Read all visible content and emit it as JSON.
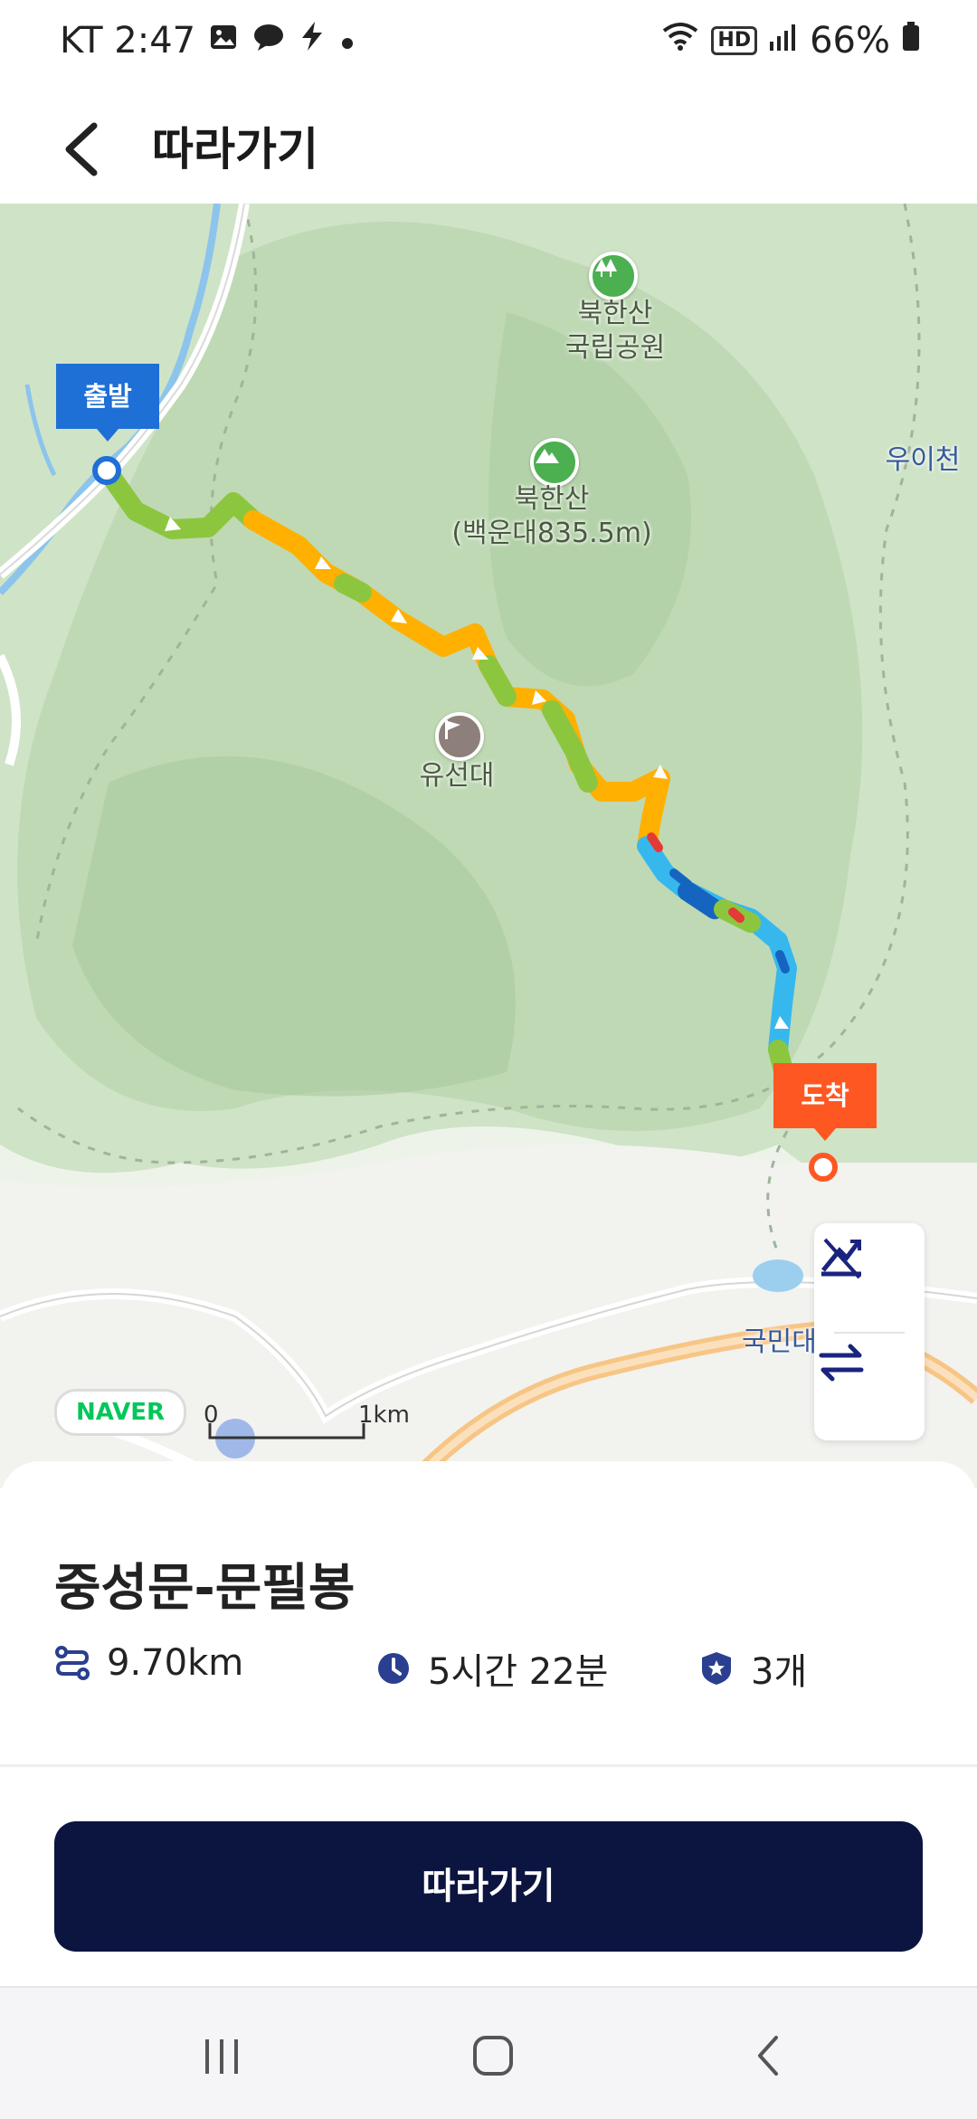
{
  "status_bar": {
    "time": "KT 2:47",
    "battery": "66%",
    "network_badge": "HD",
    "icons": [
      "image-icon",
      "chat-icon",
      "bolt-icon",
      "dot-icon",
      "wifi-icon",
      "signal-icon",
      "battery-icon"
    ]
  },
  "header": {
    "title": "따라가기",
    "back_icon": "chevron-left-icon"
  },
  "map": {
    "provider_logo": "NAVER",
    "scale_start": "0",
    "scale_end": "1km",
    "start_marker": "출발",
    "end_marker": "도착",
    "pois": [
      {
        "name": "북한산\n국립공원",
        "icon": "tree-icon"
      },
      {
        "name": "북한산\n(백운대835.5m)",
        "icon": "mountain-icon"
      },
      {
        "name": "유선대",
        "icon": "flag-icon"
      }
    ],
    "place_labels": [
      "우이천",
      "국민대"
    ],
    "tools": [
      "elevation-toggle-icon",
      "swap-direction-icon"
    ],
    "route_colors": {
      "easy": "#8cc63f",
      "moderate": "#ffb000",
      "steep": "#36b8ee",
      "very_steep": "#1565c0",
      "hard": "#e53935"
    }
  },
  "route": {
    "name": "중성문-문필봉",
    "distance": "9.70km",
    "duration": "5시간 22분",
    "badge_count": "3개"
  },
  "actions": {
    "follow_label": "따라가기"
  },
  "nav_bar": {
    "buttons": [
      "recent-apps-icon",
      "home-icon",
      "back-icon"
    ]
  },
  "colors": {
    "primary_button": "#0c1440",
    "start_marker": "#1e6fd6",
    "end_marker": "#ff5722"
  }
}
